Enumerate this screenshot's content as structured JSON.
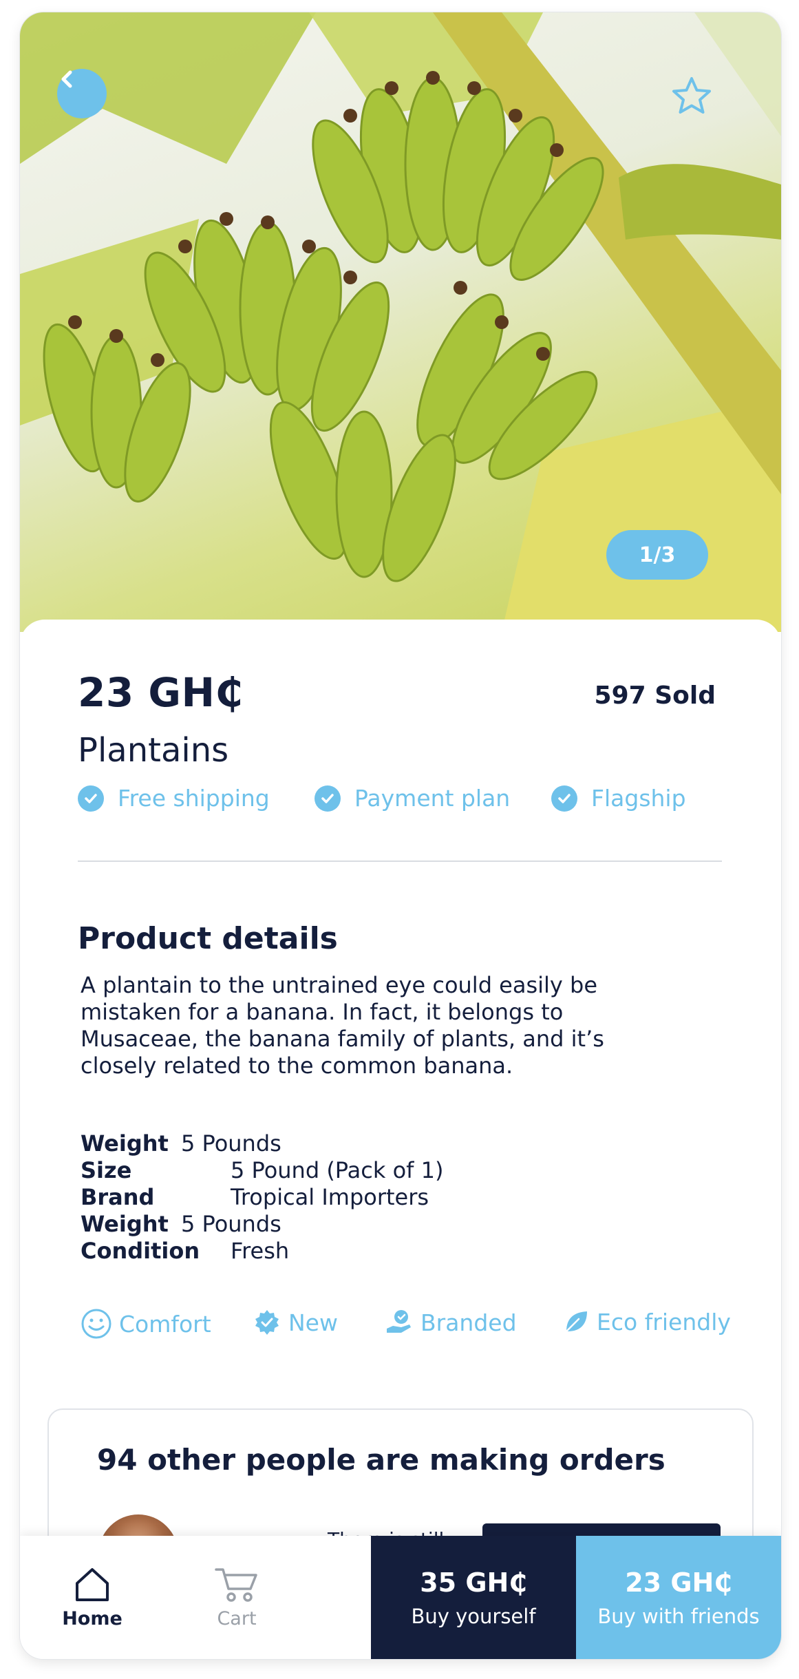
{
  "hero": {
    "image_alt": "Bunch of green plantains",
    "counter": "1/3"
  },
  "product": {
    "price": "23 GH₵",
    "sold": "597 Sold",
    "name": "Plantains",
    "features": [
      "Free shipping",
      "Payment plan",
      "Flagship"
    ]
  },
  "details": {
    "title": "Product details",
    "description": "A plantain to the untrained eye could easily be mistaken for a banana. In fact, it belongs to Musaceae, the banana family of plants, and it’s closely related to the common banana.",
    "specs": [
      {
        "label": "Weight",
        "value": "5 Pounds"
      },
      {
        "label": "Size",
        "value": "5 Pound (Pack of 1)"
      },
      {
        "label": "Brand",
        "value": "Tropical Importers"
      },
      {
        "label": "Weight",
        "value": "5 Pounds"
      },
      {
        "label": "Condition",
        "value": "Fresh"
      }
    ],
    "tags": [
      "Comfort",
      "New",
      "Branded",
      "Eco friendly"
    ]
  },
  "orders": {
    "title": "94 other people are making orders",
    "status_text": "There is still"
  },
  "bottom_nav": {
    "home": "Home",
    "cart": "Cart"
  },
  "actions": {
    "buy_yourself_price": "35 GH₵",
    "buy_yourself_label": "Buy yourself",
    "buy_friends_price": "23 GH₵",
    "buy_friends_label": "Buy with friends"
  },
  "colors": {
    "accent": "#6ec1ea",
    "dark": "#141e3c"
  }
}
